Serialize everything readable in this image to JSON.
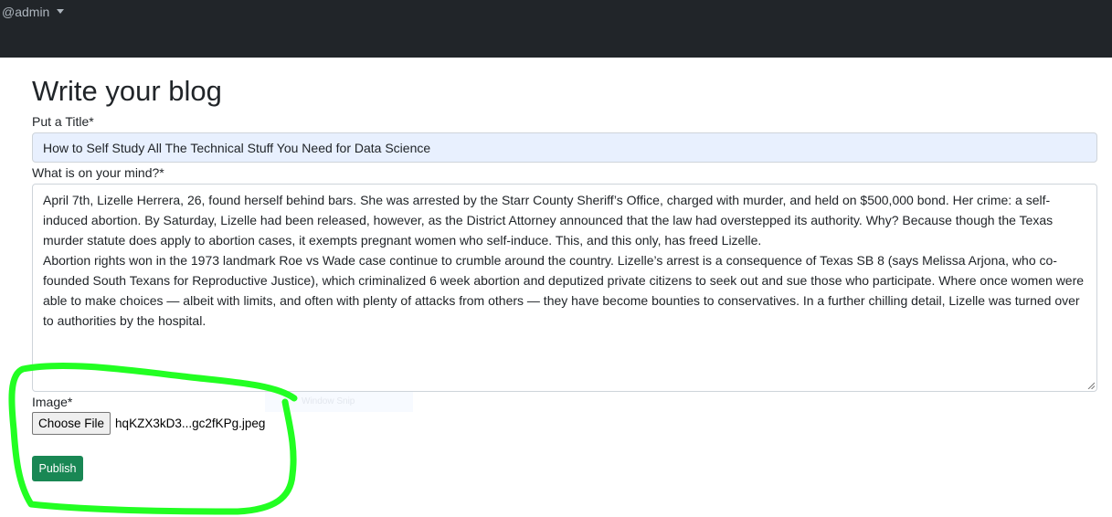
{
  "navbar": {
    "user_label": "@admin",
    "menu_icon": "caret-down-icon"
  },
  "form": {
    "heading": "Write your blog",
    "title_label": "Put a Title*",
    "title_value": "How to Self Study All The Technical Stuff You Need for Data Science",
    "body_label": "What is on your mind?*",
    "body_paragraphs": [
      "April 7th, Lizelle Herrera, 26, found herself behind bars. She was arrested by the Starr County Sheriff’s Office, charged with murder, and held on $500,000 bond. Her crime: a self-induced abortion. By Saturday, Lizelle had been released, however, as the District Attorney announced that the law had overstepped its authority. Why? Because though the Texas murder statute does apply to abortion cases, it exempts pregnant women who self-induce. This, and this only, has freed Lizelle.",
      "Abortion rights won in the 1973 landmark Roe vs Wade case continue to crumble around the country. Lizelle’s arrest is a consequence of Texas SB 8 (says Melissa Arjona, who co-founded South Texans for Reproductive Justice), which criminalized 6 week abortion and deputized private citizens to seek out and sue those who participate. Where once women were able to make choices — albeit with limits, and often with plenty of attacks from others — they have become bounties to conservatives. In a further chilling detail, Lizelle was turned over to authorities by the hospital."
    ],
    "image_label": "Image*",
    "choose_file_label": "Choose File",
    "file_name": "hqKZX3kD3...gc2fKPg.jpeg",
    "ghost_tooltip": "Window Snip",
    "publish_label": "Publish"
  },
  "colors": {
    "navbar_bg": "#212529",
    "autofill_bg": "#e8f0fe",
    "publish_bg": "#198754",
    "highlight_stroke": "#22ff22"
  }
}
